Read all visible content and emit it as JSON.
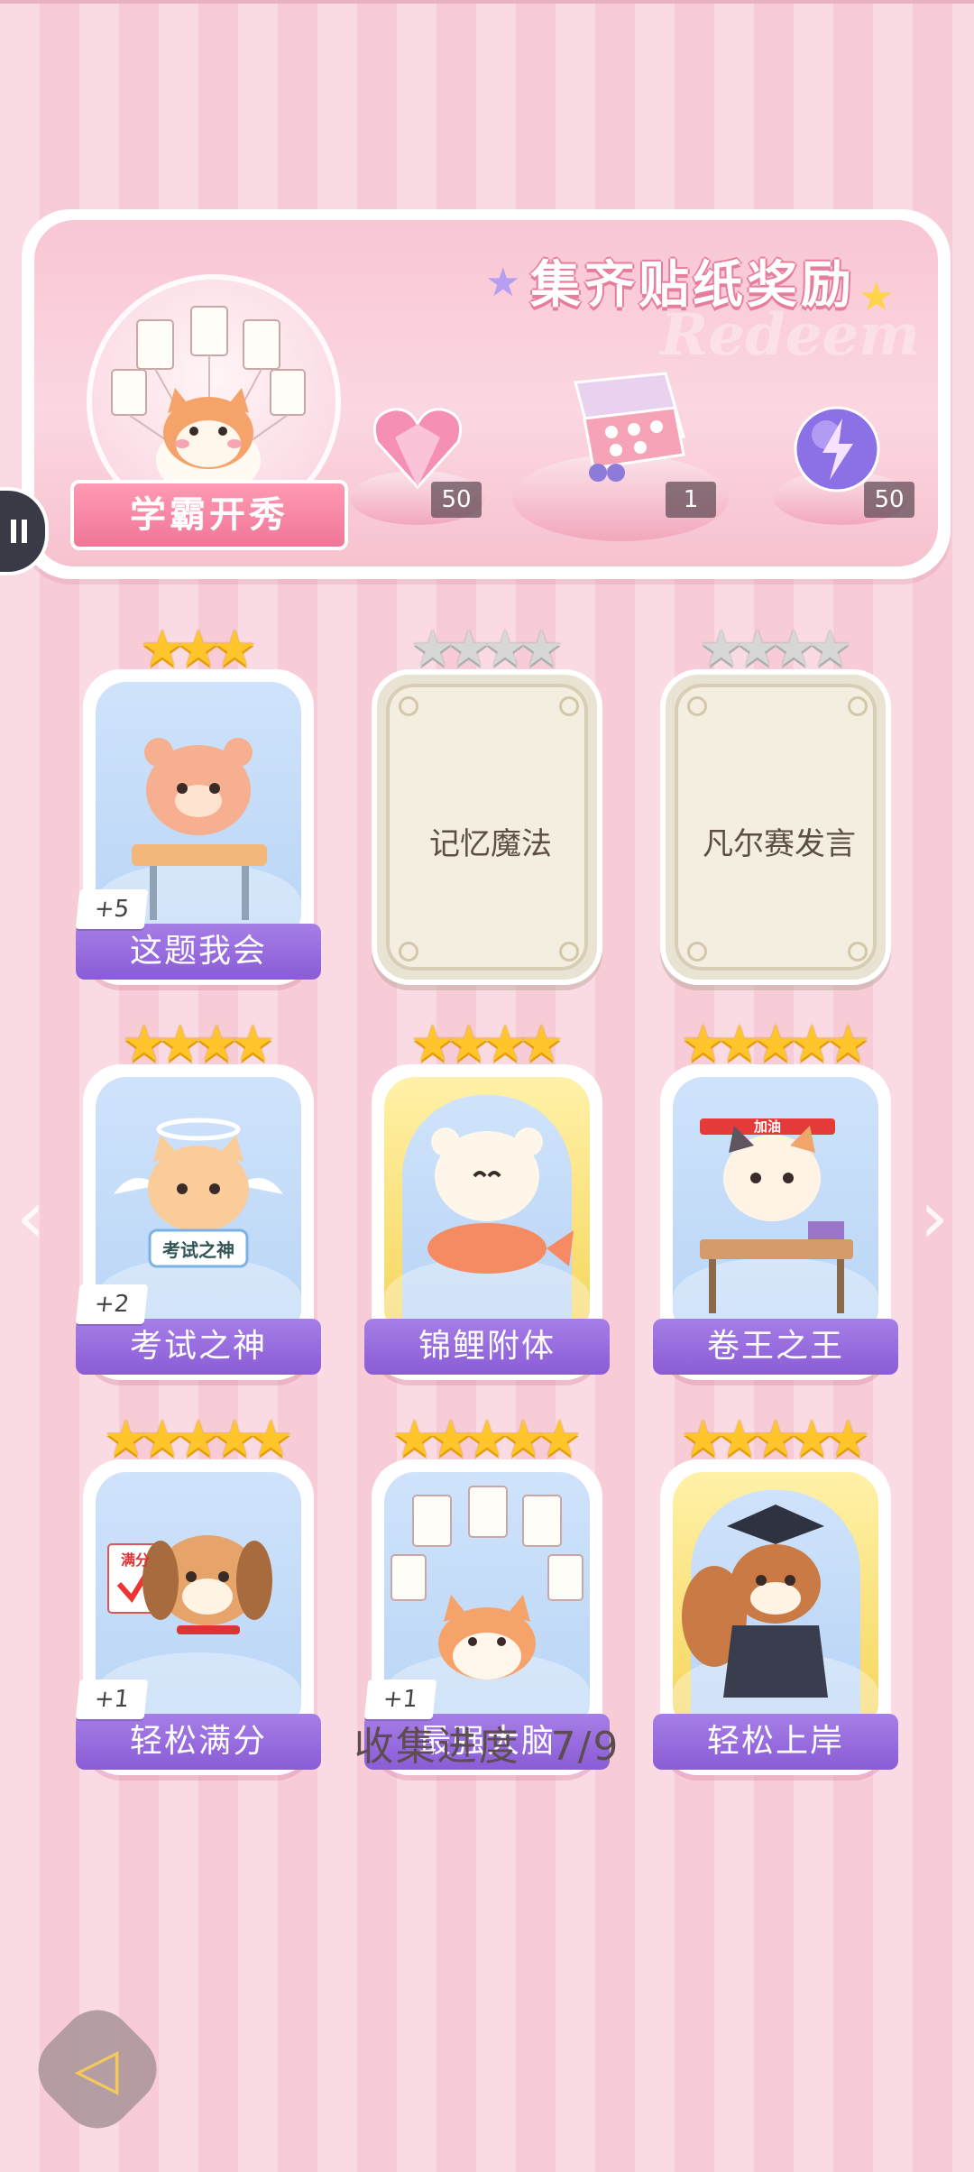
{
  "banner": {
    "title": "集齐贴纸奖励",
    "watermark": "Redeem",
    "badge_label": "学霸开秀",
    "rewards": [
      {
        "icon": "pink-heart-gem-icon",
        "count": "50"
      },
      {
        "icon": "gift-box-icon",
        "count": "1"
      },
      {
        "icon": "lightning-orb-icon",
        "count": "50"
      }
    ]
  },
  "cards": [
    {
      "name": "这题我会",
      "stars": 3,
      "max_stars": 3,
      "collected": true,
      "plus": "+5",
      "art_icon": "bear-at-desk"
    },
    {
      "name": "记忆魔法",
      "stars": 0,
      "max_stars": 4,
      "collected": false
    },
    {
      "name": "凡尔赛发言",
      "stars": 0,
      "max_stars": 4,
      "collected": false
    },
    {
      "name": "考试之神",
      "stars": 4,
      "max_stars": 4,
      "collected": true,
      "plus": "+2",
      "art_icon": "angel-cat",
      "sign": "考试之神"
    },
    {
      "name": "锦鲤附体",
      "stars": 4,
      "max_stars": 4,
      "collected": true,
      "art_icon": "bear-with-koi",
      "gold": true
    },
    {
      "name": "卷王之王",
      "stars": 5,
      "max_stars": 5,
      "collected": true,
      "art_icon": "cat-studying",
      "headband": "加油"
    },
    {
      "name": "轻松满分",
      "stars": 5,
      "max_stars": 5,
      "collected": true,
      "plus": "+1",
      "art_icon": "dog-full-score",
      "sign": "满分"
    },
    {
      "name": "最强大脑",
      "stars": 5,
      "max_stars": 5,
      "collected": true,
      "plus": "+1",
      "art_icon": "cat-with-papers"
    },
    {
      "name": "轻松上岸",
      "stars": 5,
      "max_stars": 5,
      "collected": true,
      "art_icon": "squirrel-graduate",
      "gold": true
    }
  ],
  "progress": {
    "label": "收集进度",
    "value": "7/9"
  },
  "colors": {
    "label_purple": "#8a5cd6",
    "star_gold": "#ffc52b",
    "background_pink": "#fbdbe3"
  }
}
